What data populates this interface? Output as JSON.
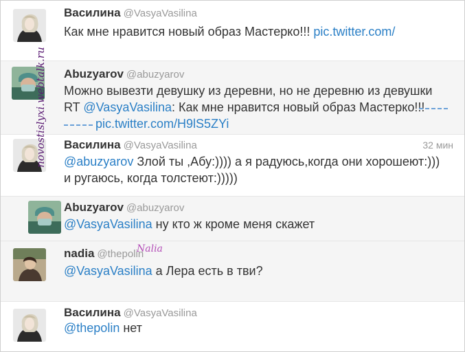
{
  "tweets": [
    {
      "name": "Василина",
      "handle": "@VasyaVasilina",
      "text_main": "Как мне нравится новый образ Мастерко!!! ",
      "link": "pic.twitter.com/"
    },
    {
      "name": "Abuzyarov",
      "handle": "@abuzyarov",
      "line1": "Можно вывезти девушку из деревни, но не деревню из девушки",
      "rt_prefix": "RT ",
      "rt_mention": "@VasyaVasilina",
      "rt_text": ": Как мне нравится новый образ Мастерко!!!",
      "link": "pic.twitter.com/H9lS5ZYi"
    },
    {
      "name": "Василина",
      "handle": "@VasyaVasilina",
      "time": "32 мин",
      "mention": "@abuzyarov",
      "text": " Злой ты ,Абу:)))) а я радуюсь,когда они хорошеют:)))",
      "line2": "и ругаюсь, когда толстеют:)))))"
    },
    {
      "name": "Abuzyarov",
      "handle": "@abuzyarov",
      "mention": "@VasyaVasilina",
      "text": " ну кто ж кроме меня скажет"
    },
    {
      "name": "nadia",
      "handle": "@thepolin",
      "mention": "@VasyaVasilina",
      "text": " а Лера есть в тви?"
    },
    {
      "name": "Василина",
      "handle": "@VasyaVasilina",
      "mention": "@thepolin",
      "text": " нет"
    }
  ],
  "watermark": "novostislyxi.webtalk.ru",
  "overlay_script": "Nalia",
  "colors": {
    "link": "#2a7fc6",
    "name": "#333333",
    "muted": "#999999",
    "highlight_bg": "#f5f5f5",
    "watermark": "#5b1c74",
    "overlay": "#b44fb8"
  }
}
